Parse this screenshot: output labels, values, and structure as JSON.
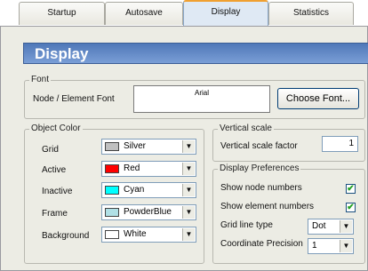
{
  "tabs": [
    {
      "label": "Startup",
      "active": false
    },
    {
      "label": "Autosave",
      "active": false
    },
    {
      "label": "Display",
      "active": true
    },
    {
      "label": "Statistics",
      "active": false
    }
  ],
  "header": {
    "title": "Display"
  },
  "font_group": {
    "label": "Font",
    "field_label": "Node / Element Font",
    "font_value": "Arial",
    "choose_button": "Choose Font..."
  },
  "object_color": {
    "label": "Object Color",
    "rows": [
      {
        "label": "Grid",
        "value": "Silver",
        "color": "#c0c0c0"
      },
      {
        "label": "Active",
        "value": "Red",
        "color": "#ff0000"
      },
      {
        "label": "Inactive",
        "value": "Cyan",
        "color": "#00ffff"
      },
      {
        "label": "Frame",
        "value": "PowderBlue",
        "color": "#b0e0e6"
      },
      {
        "label": "Background",
        "value": "White",
        "color": "#ffffff"
      }
    ]
  },
  "vertical_scale": {
    "label": "Vertical scale",
    "factor_label": "Vertical scale factor",
    "factor_value": "1"
  },
  "display_prefs": {
    "label": "Display Preferences",
    "show_node_numbers_label": "Show node numbers",
    "show_node_numbers": true,
    "show_element_numbers_label": "Show element numbers",
    "show_element_numbers": true,
    "grid_line_type_label": "Grid line type",
    "grid_line_type_value": "Dot",
    "coord_precision_label": "Coordinate Precision",
    "coord_precision_value": "1"
  },
  "icons": {
    "checkmark": "check-icon",
    "dropdown": "chevron-down-icon"
  }
}
